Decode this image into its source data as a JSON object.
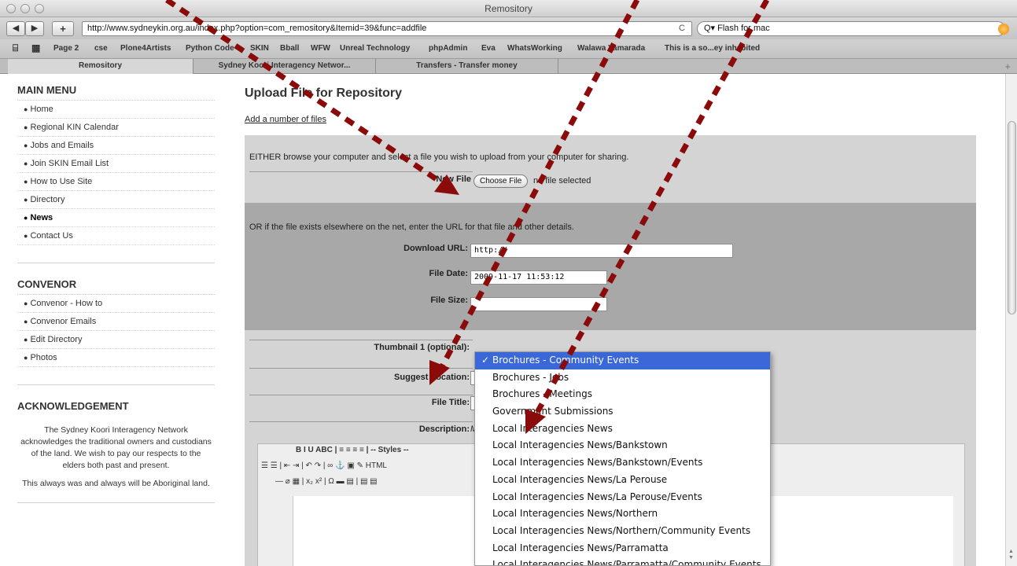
{
  "window": {
    "title": "Remository"
  },
  "toolbar": {
    "back": "◀",
    "forward": "▶",
    "add": "+",
    "url": "http://www.sydneykin.org.au/index.php?option=com_remository&Itemid=39&func=addfile",
    "reload": "C",
    "search": "Q▾ Flash for mac"
  },
  "bookmarks": [
    "Page 2",
    "cse",
    "Plone4Artists",
    "Python Code",
    "SKIN",
    "Bball",
    "WFW",
    "Unreal Technology",
    "phpAdmin",
    "Eva",
    "WhatsWorking",
    "Walawa Yamarada",
    "This is a so...ey inhabited"
  ],
  "tabs": [
    "Remository",
    "Sydney Koori Interagency Networ...",
    "Transfers - Transfer money"
  ],
  "sidebar": {
    "main_menu": {
      "heading": "MAIN MENU",
      "items": [
        "Home",
        "Regional KIN Calendar",
        "Jobs and Emails",
        "Join SKIN Email List",
        "How to Use Site",
        "Directory",
        "News",
        "Contact Us"
      ]
    },
    "convenor": {
      "heading": "CONVENOR",
      "items": [
        "Convenor - How to",
        "Convenor Emails",
        "Edit Directory",
        "Photos"
      ]
    },
    "acknowledgement": {
      "heading": "ACKNOWLEDGEMENT",
      "text1": "The Sydney Koori Interagency Network acknowledges the traditional owners and custodians of the land. We wish to pay our respects to the elders both past and present.",
      "text2": "This always was and always will be Aboriginal land."
    }
  },
  "main": {
    "title": "Upload File for Repository",
    "add_link": "Add a number of files",
    "browse_text": "EITHER browse your computer and select a file you wish to upload from your computer for sharing.",
    "new_file_label": "New File",
    "choose_file": "Choose File",
    "no_file": "no file selected",
    "url_text": "OR if the file exists elsewhere on the net, enter the URL for that file and other details.",
    "download_url_label": "Download URL:",
    "download_url_value": "http://",
    "file_date_label": "File Date:",
    "file_date_value": "2009-11-17 11:53:12",
    "file_size_label": "File Size:",
    "thumbnail_label": "Thumbnail 1 (optional):",
    "suggest_location_label": "Suggest Location:",
    "file_title_label": "File Title:",
    "description_label": "Description:",
    "description_suffix": "M",
    "editor_row1": "B  I  U  ABC |  ≡  ≡  ≡  ≡  | -- Styles --",
    "editor_row2": "☰  ☰ |  ⇤  ⇥ |  ↶  ↷ |  ∞  ⚓  ▣  ✎  HTML",
    "editor_row3": "—  ⌀  ▦ |  x₂  x² |  Ω  ▬  ▤ |  ▤  ▤"
  },
  "dropdown": {
    "selected_index": 0,
    "options": [
      "Brochures - Community Events",
      "Brochures - Jobs",
      "Brochures - Meetings",
      "Government Submissions",
      "Local Interagencies News",
      "Local Interagencies News/Bankstown",
      "Local Interagencies News/Bankstown/Events",
      "Local Interagencies News/La Perouse",
      "Local Interagencies News/La Perouse/Events",
      "Local Interagencies News/Northern",
      "Local Interagencies News/Northern/Community Events",
      "Local Interagencies News/Parramatta",
      "Local Interagencies News/Parramatta/Community Events"
    ]
  },
  "colors": {
    "arrow": "#8b0a0a",
    "selection": "#3a68d8",
    "panel_light": "#d4d4d4",
    "panel_dark": "#a8a8a8"
  }
}
